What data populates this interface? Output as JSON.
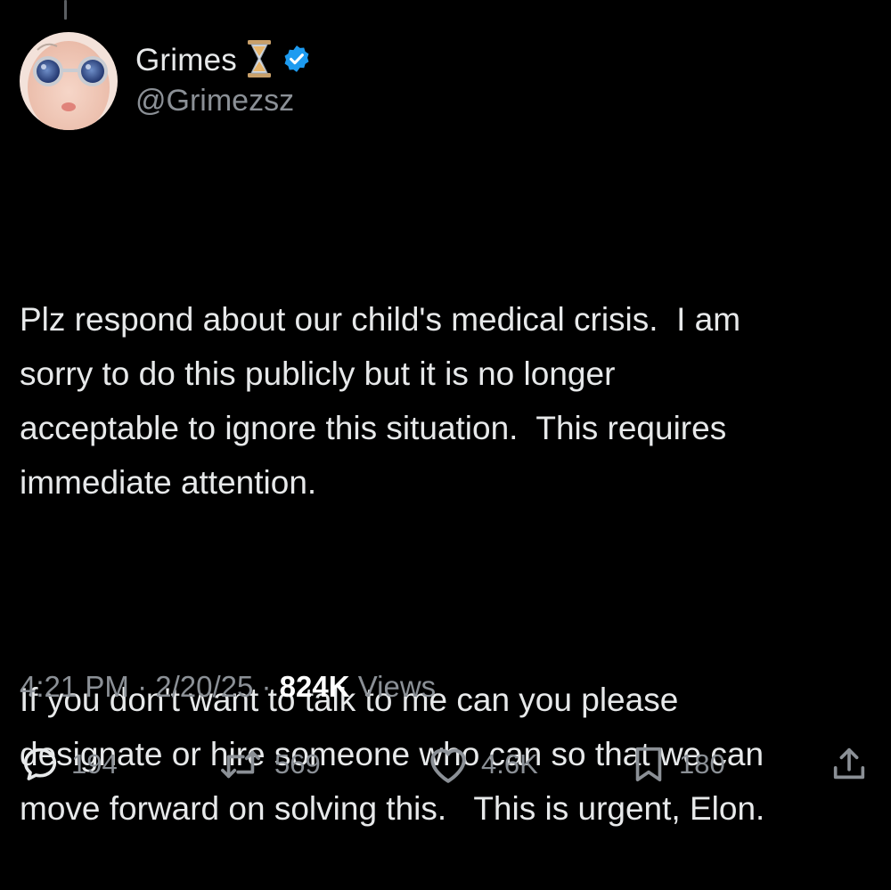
{
  "colors": {
    "background": "#000000",
    "text_primary": "#e7e9ea",
    "text_secondary": "#8b9096",
    "verified_badge": "#1d9bf0"
  },
  "author": {
    "display_name": "Grimes",
    "handle": "@Grimezsz",
    "avatar_icon": "avatar-image",
    "emoji_icon": "hourglass-icon",
    "badge_icon": "verified-badge-icon"
  },
  "tweet": {
    "paragraphs": [
      "Plz respond about our child's medical crisis.  I am\nsorry to do this publicly but it is no longer\nacceptable to ignore this situation.  This requires\nimmediate attention.",
      "If you don't want to talk to me can you please\ndesignate or hire someone who can so that we can\nmove forward on solving this.   This is urgent, Elon."
    ]
  },
  "meta": {
    "time": "4:21 PM",
    "separator": " · ",
    "date": "2/20/25",
    "views_count": "824K",
    "views_label": " Views"
  },
  "actions": {
    "replies": {
      "icon": "reply-icon",
      "count": "194"
    },
    "reposts": {
      "icon": "repost-icon",
      "count": "569"
    },
    "likes": {
      "icon": "heart-icon",
      "count": "4.6K"
    },
    "bookmarks": {
      "icon": "bookmark-icon",
      "count": "180"
    },
    "share": {
      "icon": "share-icon"
    }
  }
}
